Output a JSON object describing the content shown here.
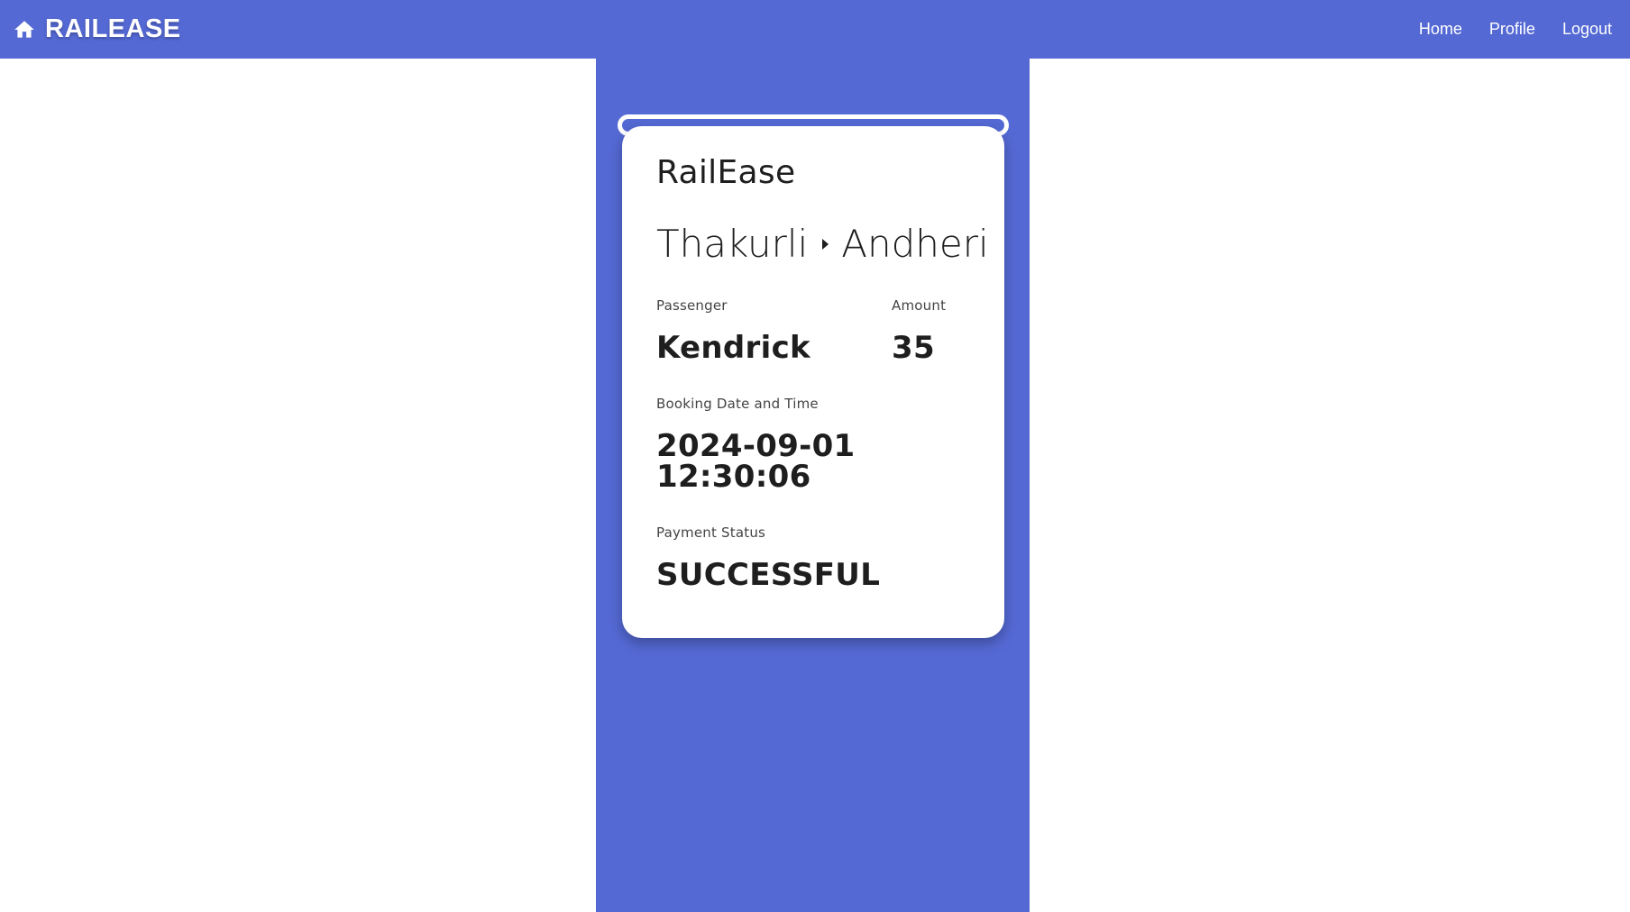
{
  "navbar": {
    "brand": "RAILEASE",
    "brand_icon": "home-icon",
    "links": [
      "Home",
      "Profile",
      "Logout"
    ]
  },
  "ticket": {
    "title": "RailEase",
    "from": "Thakurli",
    "to": "Andheri",
    "route_icon": "arrow-right-icon",
    "passenger_label": "Passenger",
    "passenger": "Kendrick",
    "amount_label": "Amount",
    "amount": "35",
    "booking_label": "Booking Date and Time",
    "booking_datetime": "2024-09-01 12:30:06",
    "status_label": "Payment Status",
    "status": "SUCCESSFUL"
  },
  "colors": {
    "primary": "#5469d4",
    "background": "#ffffff",
    "text": "#1e1e1e"
  }
}
